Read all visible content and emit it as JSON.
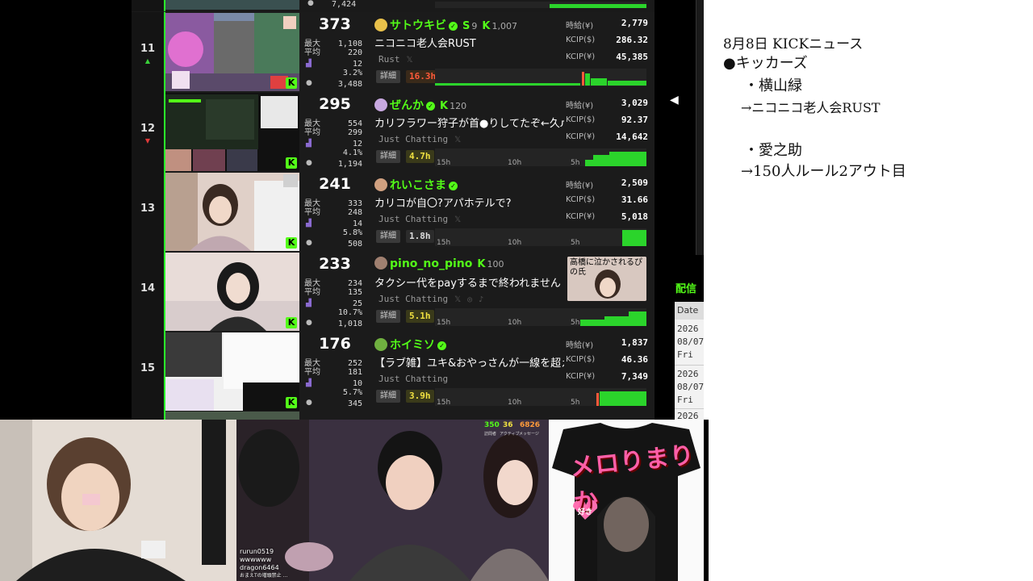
{
  "top_partial": {
    "value": "7,424"
  },
  "rows": [
    {
      "rank": "11",
      "trend": "▲",
      "trend_color": "#3ad03a",
      "viewers": "373",
      "max_label": "最大",
      "avg_label": "平均",
      "max": "1,108",
      "avg": "220",
      "msg_a": "12",
      "msg_b": "3.2%",
      "followers_total": "3,488",
      "streamer": "サトウキビ",
      "subs_label": "S",
      "subs": "9",
      "follows": "1,007",
      "title": "ニコニコ老人会RUST",
      "category": "Rust",
      "duration": "16.3h",
      "dur_color": "#ff5a3a",
      "earn_labels": [
        "時給(¥)",
        "KCIP($)",
        "KCIP(¥)"
      ],
      "earn_values": [
        "2,779",
        "286.32",
        "45,385"
      ],
      "graph_labels": [],
      "avatar_color": "#e8c04a",
      "thumb_bg": "#6a7fa0"
    },
    {
      "rank": "12",
      "trend": "▼",
      "trend_color": "#e03a3a",
      "viewers": "295",
      "max_label": "最大",
      "avg_label": "平均",
      "max": "554",
      "avg": "299",
      "msg_a": "12",
      "msg_b": "4.1%",
      "followers_total": "1,194",
      "streamer": "ぜんか",
      "follows": "120",
      "title": "カリフラワー狩子が首●りしてたぞ←久л",
      "category": "Just Chatting",
      "duration": "4.7h",
      "dur_color": "#f0e040",
      "earn_labels": [
        "時給(¥)",
        "KCIP($)",
        "KCIP(¥)"
      ],
      "earn_values": [
        "3,029",
        "92.37",
        "14,642"
      ],
      "graph_labels": [
        "15h",
        "10h",
        "5h"
      ],
      "avatar_color": "#c8a8e0",
      "thumb_bg": "#202820"
    },
    {
      "rank": "13",
      "trend": "",
      "trend_color": "#888",
      "viewers": "241",
      "max_label": "最大",
      "avg_label": "平均",
      "max": "333",
      "avg": "248",
      "msg_a": "14",
      "msg_b": "5.8%",
      "followers_total": "508",
      "streamer": "れいこさま",
      "title": "カリコが自〇?アパホテルで?",
      "category": "Just Chatting",
      "duration": "1.8h",
      "dur_color": "#dddddd",
      "earn_labels": [
        "時給(¥)",
        "KCIP($)",
        "KCIP(¥)"
      ],
      "earn_values": [
        "2,509",
        "31.66",
        "5,018"
      ],
      "graph_labels": [
        "15h",
        "10h",
        "5h"
      ],
      "avatar_color": "#d0a080",
      "thumb_bg": "#d8c8c0"
    },
    {
      "rank": "14",
      "trend": "",
      "trend_color": "#888",
      "viewers": "233",
      "max_label": "最大",
      "avg_label": "平均",
      "max": "234",
      "avg": "135",
      "msg_a": "25",
      "msg_b": "10.7%",
      "followers_total": "1,018",
      "streamer": "pino_no_pino",
      "follows": "100",
      "title": "タクシー代をpayするまで終われません",
      "category": "Just Chatting",
      "duration": "5.1h",
      "dur_color": "#f0e040",
      "clip_caption": "高橋に泣かされるぴの氏",
      "graph_labels": [
        "15h",
        "10h",
        "5h"
      ],
      "avatar_color": "#a08070",
      "thumb_bg": "#e0d4d0"
    },
    {
      "rank": "15",
      "trend": "",
      "trend_color": "#888",
      "viewers": "176",
      "max_label": "最大",
      "avg_label": "平均",
      "max": "252",
      "avg": "181",
      "msg_a": "10",
      "msg_b": "5.7%",
      "followers_total": "345",
      "streamer": "ホイミソ",
      "title": "【ラブ雑】ユキ&おやっさんが一線を超え",
      "category": "Just Chatting",
      "duration": "3.9h",
      "dur_color": "#f0e040",
      "earn_labels": [
        "時給(¥)",
        "KCIP($)",
        "KCIP(¥)"
      ],
      "earn_values": [
        "1,837",
        "46.36",
        "7,349"
      ],
      "graph_labels": [
        "15h",
        "10h",
        "5h"
      ],
      "avatar_color": "#70b040",
      "thumb_bg": "#e8e8e8"
    }
  ],
  "detail_label": "詳細",
  "side": {
    "title": "配信",
    "column": "Date",
    "entries": [
      {
        "year": "2026",
        "date": "08/07",
        "day": "Fri"
      },
      {
        "year": "2026",
        "date": "08/07",
        "day": "Fri"
      },
      {
        "year": "2026"
      }
    ]
  },
  "notes": {
    "lines": [
      "8月8日 KICKニュース",
      "●キッカーズ",
      "・横山緑",
      "→ニコニコ老人会RUST",
      "・愛之助",
      "→150人ルール2アウト目"
    ]
  },
  "cams": {
    "overlay_numbers": [
      "350",
      "36",
      "6826"
    ],
    "overlay_labels": [
      "訪問者",
      "アクティブ",
      "メッセージ"
    ],
    "chat": [
      {
        "user": "rurun0519",
        "text": "wwwwww"
      },
      {
        "user": "dragon6464",
        "text": "おまえTの増頭禁止 ..."
      }
    ],
    "shirt_text": "メロりまりか",
    "shirt_heart": "好き"
  },
  "colors": {
    "kick_green": "#53fc18",
    "panel_bg": "#1b1b1b"
  }
}
